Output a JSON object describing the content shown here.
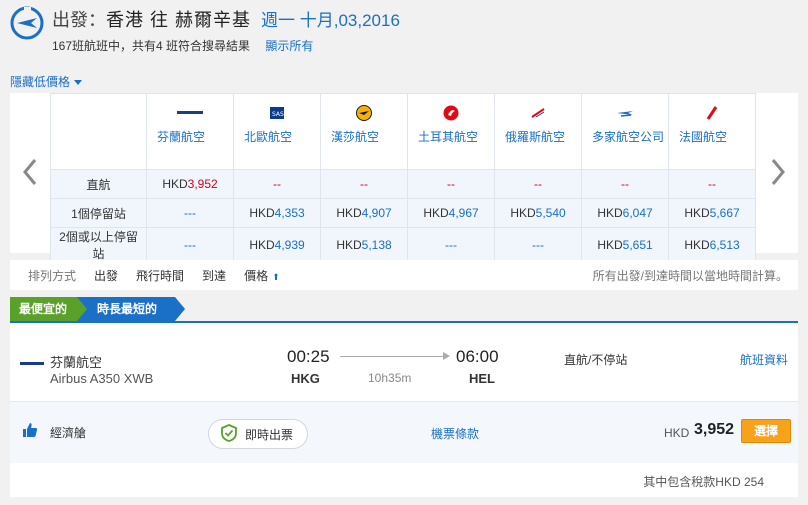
{
  "header": {
    "label": "出發：",
    "route": "香港 往 赫爾辛基",
    "date": "週一 十月,03,2016",
    "summary": "167班航班中，共有4 班符合搜尋結果",
    "show_all": "顯示所有"
  },
  "matrix": {
    "hide_toggle": "隱藏低價格",
    "airlines": [
      {
        "name": "芬蘭航空",
        "logo": "finnair-logo"
      },
      {
        "name": "北歐航空",
        "logo": "sas-logo"
      },
      {
        "name": "漢莎航空",
        "logo": "lufthansa-logo"
      },
      {
        "name": "土耳其航空",
        "logo": "turkish-airlines-logo"
      },
      {
        "name": "俄羅斯航空",
        "logo": "aeroflot-logo"
      },
      {
        "name": "多家航空公司",
        "logo": "multiple-airlines-logo"
      },
      {
        "name": "法國航空",
        "logo": "air-france-logo"
      }
    ],
    "rows": [
      {
        "label": "直航",
        "cells": [
          {
            "cur": "HKD",
            "num": "3,952",
            "cheapest": true
          },
          {
            "dash": "--"
          },
          {
            "dash": "--"
          },
          {
            "dash": "--"
          },
          {
            "dash": "--"
          },
          {
            "dash": "--"
          },
          {
            "dash": "--"
          }
        ]
      },
      {
        "label": "1個停留站",
        "cells": [
          {
            "dash": "---"
          },
          {
            "cur": "HKD",
            "num": "4,353"
          },
          {
            "cur": "HKD",
            "num": "4,907"
          },
          {
            "cur": "HKD",
            "num": "4,967"
          },
          {
            "cur": "HKD",
            "num": "5,540"
          },
          {
            "cur": "HKD",
            "num": "6,047"
          },
          {
            "cur": "HKD",
            "num": "5,667"
          }
        ]
      },
      {
        "label": "2個或以上停留站",
        "cells": [
          {
            "dash": "---"
          },
          {
            "cur": "HKD",
            "num": "4,939"
          },
          {
            "cur": "HKD",
            "num": "5,138"
          },
          {
            "dash": "---"
          },
          {
            "dash": "---"
          },
          {
            "cur": "HKD",
            "num": "5,651"
          },
          {
            "cur": "HKD",
            "num": "6,513"
          }
        ]
      }
    ]
  },
  "sortbar": {
    "label": "排列方式",
    "items": [
      "出發",
      "飛行時間",
      "到達",
      "價格"
    ],
    "note": "所有出發/到達時間以當地時間計算。"
  },
  "tags": {
    "cheapest": "最便宜的",
    "shortest": "時長最短的"
  },
  "result": {
    "airline": "芬蘭航空",
    "aircraft": "Airbus A350 XWB",
    "dep_time": "00:25",
    "dep_code": "HKG",
    "duration": "10h35m",
    "arr_time": "06:00",
    "arr_code": "HEL",
    "stops": "直航/不停站",
    "details": "航班資料",
    "fare_class": "經濟艙",
    "instant": "即時出票",
    "fare_terms": "機票條款",
    "currency": "HKD",
    "amount": "3,952",
    "select": "選擇",
    "tax_note": "其中包含稅款HKD 254"
  },
  "colors": {
    "accent": "#1a6fc7",
    "green": "#5aa12a",
    "orange": "#f7a21b",
    "cheapest": "#d0021b"
  }
}
